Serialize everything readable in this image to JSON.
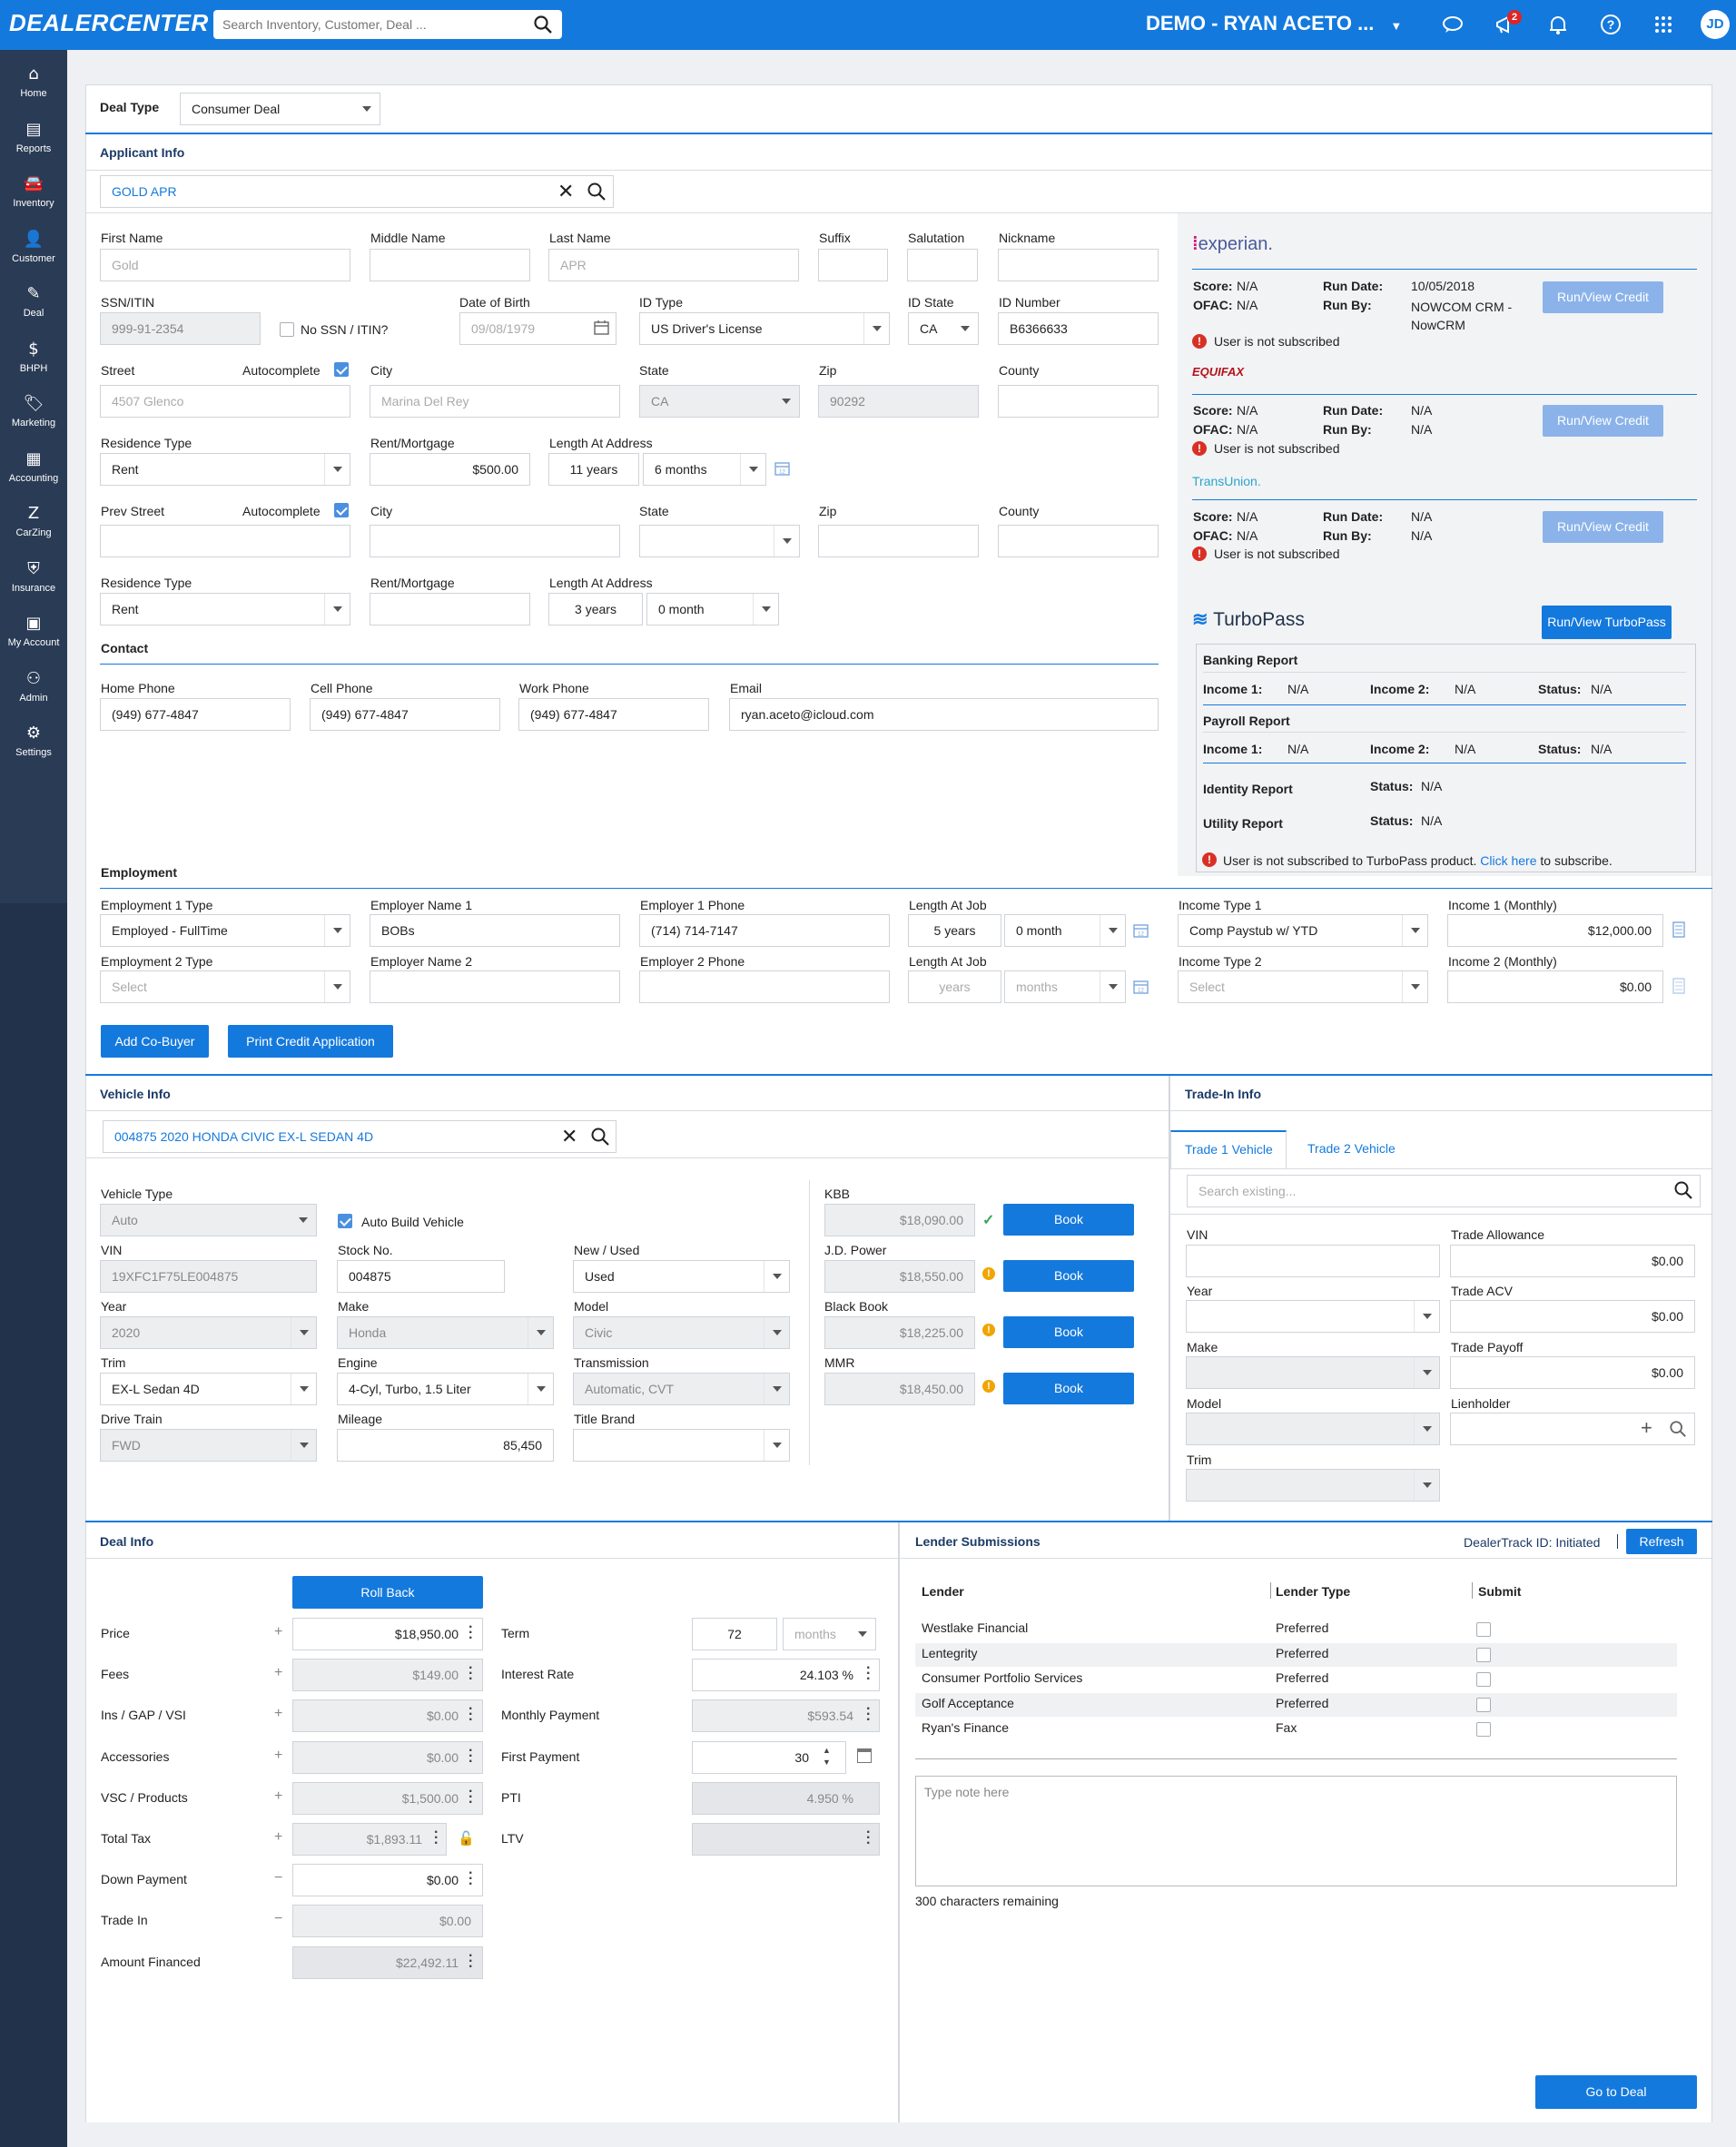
{
  "topbar": {
    "logo": "DEALERCENTER",
    "search_placeholder": "Search Inventory, Customer, Deal ...",
    "dealer": "DEMO - RYAN ACETO ...",
    "notifications": "2",
    "avatar": "JD"
  },
  "sidebar": [
    {
      "label": "Home",
      "icon": "home-icon"
    },
    {
      "label": "Reports",
      "icon": "reports-icon"
    },
    {
      "label": "Inventory",
      "icon": "car-icon"
    },
    {
      "label": "Customer",
      "icon": "customer-icon"
    },
    {
      "label": "Deal",
      "icon": "deal-icon"
    },
    {
      "label": "BHPH",
      "icon": "bhph-icon"
    },
    {
      "label": "Marketing",
      "icon": "tag-icon"
    },
    {
      "label": "Accounting",
      "icon": "calculator-icon"
    },
    {
      "label": "CarZing",
      "icon": "carzing-icon"
    },
    {
      "label": "Insurance",
      "icon": "shield-icon"
    },
    {
      "label": "My Account",
      "icon": "account-icon"
    },
    {
      "label": "Admin",
      "icon": "admin-icon"
    },
    {
      "label": "Settings",
      "icon": "gear-icon"
    }
  ],
  "deal_type": {
    "label": "Deal Type",
    "value": "Consumer Deal"
  },
  "applicant": {
    "title": "Applicant Info",
    "search_value": "GOLD APR",
    "labels": {
      "first": "First Name",
      "middle": "Middle Name",
      "last": "Last Name",
      "suffix": "Suffix",
      "salutation": "Salutation",
      "nickname": "Nickname",
      "ssn": "SSN/ITIN",
      "no_ssn": "No SSN / ITIN?",
      "dob": "Date of Birth",
      "id_type": "ID Type",
      "id_state": "ID State",
      "id_number": "ID Number",
      "street": "Street",
      "autocomplete": "Autocomplete",
      "city": "City",
      "state": "State",
      "zip": "Zip",
      "county": "County",
      "residence_type": "Residence Type",
      "rent": "Rent/Mortgage",
      "length_addr": "Length At Address",
      "prev_street": "Prev Street"
    },
    "first_name": "Gold",
    "last_name": "APR",
    "ssn": "999-91-2354",
    "dob": "09/08/1979",
    "id_type": "US Driver's License",
    "id_state": "CA",
    "id_number": "B6366633",
    "street": "4507 Glenco",
    "city": "Marina Del Rey",
    "state": "CA",
    "zip": "90292",
    "residence_type": "Rent",
    "rent": "$500.00",
    "length_years": "11 years",
    "length_months": "6 months",
    "prev_residence_type": "Rent",
    "prev_length_years": "3 years",
    "prev_length_months": "0 month"
  },
  "contact": {
    "title": "Contact",
    "home_label": "Home Phone",
    "cell_label": "Cell Phone",
    "work_label": "Work Phone",
    "email_label": "Email",
    "home": "(949) 677-4847",
    "cell": "(949) 677-4847",
    "work": "(949) 677-4847",
    "email": "ryan.aceto@icloud.com"
  },
  "credit": {
    "experian": {
      "logo": "experian.",
      "score": "N/A",
      "ofac": "N/A",
      "run_date": "10/05/2018",
      "run_by": "NOWCOM CRM - NowCRM"
    },
    "equifax": {
      "logo": "EQUIFAX",
      "score": "N/A",
      "ofac": "N/A",
      "run_date": "N/A",
      "run_by": "N/A"
    },
    "transunion": {
      "logo": "TransUnion.",
      "score": "N/A",
      "ofac": "N/A",
      "run_date": "N/A",
      "run_by": "N/A"
    },
    "score_label": "Score:",
    "ofac_label": "OFAC:",
    "run_date_label": "Run Date:",
    "run_by_label": "Run By:",
    "not_subscribed": "User is not subscribed",
    "button": "Run/View Credit"
  },
  "turbopass": {
    "logo": "TurboPass",
    "button": "Run/View TurboPass",
    "banking": "Banking Report",
    "payroll": "Payroll Report",
    "identity": "Identity Report",
    "utility": "Utility Report",
    "income1": "Income 1:",
    "income2": "Income 2:",
    "status": "Status:",
    "na": "N/A",
    "msg": "User is not subscribed to TurboPass product.",
    "link": "Click here",
    "msg2": "to subscribe."
  },
  "employment": {
    "title": "Employment",
    "emp1_type_label": "Employment 1 Type",
    "emp1_type": "Employed - FullTime",
    "emp1_name_label": "Employer Name 1",
    "emp1_name": "BOBs",
    "emp1_phone_label": "Employer 1 Phone",
    "emp1_phone": "(714) 714-7147",
    "len_label": "Length At Job",
    "len1_years": "5 years",
    "len1_months": "0 month",
    "inc1_type_label": "Income Type 1",
    "inc1_type": "Comp Paystub w/ YTD",
    "inc1_label": "Income 1 (Monthly)",
    "inc1": "$12,000.00",
    "emp2_type_label": "Employment 2 Type",
    "emp2_type": "Select",
    "emp2_name_label": "Employer Name 2",
    "emp2_phone_label": "Employer 2 Phone",
    "len2_years": "years",
    "len2_months": "months",
    "inc2_type_label": "Income Type 2",
    "inc2_type": "Select",
    "inc2_label": "Income 2 (Monthly)",
    "inc2": "$0.00"
  },
  "buttons": {
    "add_cobuyer": "Add Co-Buyer",
    "print_credit": "Print Credit Application",
    "book": "Book",
    "roll_back": "Roll Back",
    "refresh": "Refresh",
    "go_to_deal": "Go to Deal"
  },
  "vehicle": {
    "title": "Vehicle Info",
    "search_value": "004875 2020 HONDA CIVIC EX-L SEDAN 4D",
    "type_label": "Vehicle Type",
    "type": "Auto",
    "auto_build": "Auto Build Vehicle",
    "vin_label": "VIN",
    "vin": "19XFC1F75LE004875",
    "stock_label": "Stock No.",
    "stock": "004875",
    "newused_label": "New / Used",
    "newused": "Used",
    "year_label": "Year",
    "year": "2020",
    "make_label": "Make",
    "make": "Honda",
    "model_label": "Model",
    "model": "Civic",
    "trim_label": "Trim",
    "trim": "EX-L Sedan 4D",
    "engine_label": "Engine",
    "engine": "4-Cyl, Turbo, 1.5 Liter",
    "trans_label": "Transmission",
    "trans": "Automatic, CVT",
    "drive_label": "Drive Train",
    "drive": "FWD",
    "mileage_label": "Mileage",
    "mileage": "85,450",
    "title_label": "Title Brand",
    "books": [
      {
        "name": "KBB",
        "value": "$18,090.00",
        "status": "ok"
      },
      {
        "name": "J.D. Power",
        "value": "$18,550.00",
        "status": "warn"
      },
      {
        "name": "Black Book",
        "value": "$18,225.00",
        "status": "warn"
      },
      {
        "name": "MMR",
        "value": "$18,450.00",
        "status": "warn"
      }
    ]
  },
  "tradein": {
    "title": "Trade-In Info",
    "tab1": "Trade 1 Vehicle",
    "tab2": "Trade 2 Vehicle",
    "search_placeholder": "Search existing...",
    "vin_label": "VIN",
    "year_label": "Year",
    "make_label": "Make",
    "model_label": "Model",
    "trim_label": "Trim",
    "allowance_label": "Trade Allowance",
    "allowance": "$0.00",
    "acv_label": "Trade ACV",
    "acv": "$0.00",
    "payoff_label": "Trade Payoff",
    "payoff": "$0.00",
    "lienholder_label": "Lienholder"
  },
  "deal": {
    "title": "Deal Info",
    "price_label": "Price",
    "price": "$18,950.00",
    "fees_label": "Fees",
    "fees": "$149.00",
    "ins_label": "Ins / GAP / VSI",
    "ins": "$0.00",
    "acc_label": "Accessories",
    "acc": "$0.00",
    "vsc_label": "VSC / Products",
    "vsc": "$1,500.00",
    "tax_label": "Total Tax",
    "tax": "$1,893.11",
    "down_label": "Down Payment",
    "down": "$0.00",
    "tradein_label": "Trade In",
    "tradein": "$0.00",
    "financed_label": "Amount Financed",
    "financed": "$22,492.11",
    "term_label": "Term",
    "term": "72",
    "term_unit": "months",
    "rate_label": "Interest Rate",
    "rate": "24.103 %",
    "monthly_label": "Monthly Payment",
    "monthly": "$593.54",
    "first_label": "First Payment",
    "first": "30",
    "pti_label": "PTI",
    "pti": "4.950 %",
    "ltv_label": "LTV"
  },
  "lender": {
    "title": "Lender Submissions",
    "dealertrack": "DealerTrack ID: Initiated",
    "col_lender": "Lender",
    "col_type": "Lender Type",
    "col_submit": "Submit",
    "rows": [
      {
        "name": "Westlake Financial",
        "type": "Preferred"
      },
      {
        "name": "Lentegrity",
        "type": "Preferred"
      },
      {
        "name": "Consumer Portfolio Services",
        "type": "Preferred"
      },
      {
        "name": "Golf Acceptance",
        "type": "Preferred"
      },
      {
        "name": "Ryan's Finance",
        "type": "Fax"
      }
    ],
    "note_placeholder": "Type note here",
    "remaining": "300 characters remaining"
  },
  "colors": {
    "brand": "#1479dd",
    "sidebar": "#2a3b55",
    "warn": "#f0a500",
    "ok": "#3aa655",
    "error": "#d93025"
  }
}
